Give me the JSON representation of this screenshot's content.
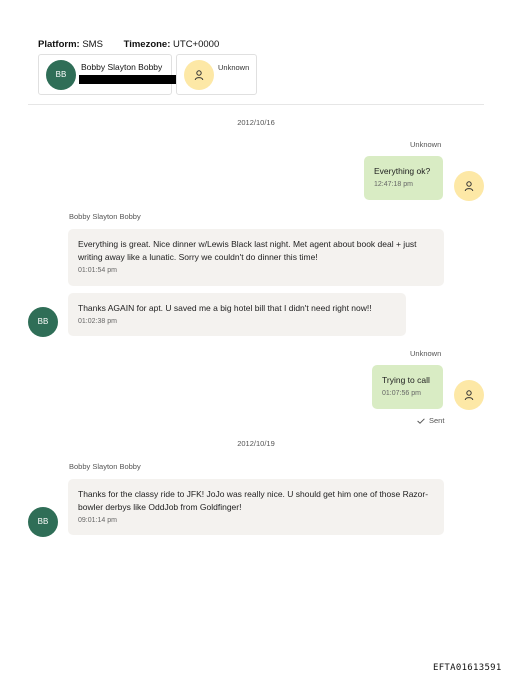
{
  "header": {
    "platform_label": "Platform:",
    "platform_value": "SMS",
    "timezone_label": "Timezone:",
    "timezone_value": "UTC+0000"
  },
  "participants": [
    {
      "initials": "BB",
      "name": "Bobby Slayton Bobby",
      "avatar_color": "#2f6e57"
    },
    {
      "name": "Unknown",
      "avatar_color": "#fde8a6",
      "icon": "person-icon"
    }
  ],
  "conversation": {
    "date1": "2012/10/16",
    "msg1": {
      "sender": "Unknown",
      "text": "Everything ok?",
      "time": "12:47:18 pm"
    },
    "msg2": {
      "sender": "Bobby Slayton Bobby",
      "text": "Everything is great. Nice dinner w/Lewis Black last night. Met agent about book deal + just writing away like a lunatic. Sorry we couldn't do dinner this time!",
      "time": "01:01:54 pm"
    },
    "msg3": {
      "text": "Thanks AGAIN for apt. U saved me a big hotel bill that I didn't need right now!!",
      "time": "01:02:38 pm",
      "initials": "BB"
    },
    "msg4": {
      "sender": "Unknown",
      "text": "Trying to call",
      "time": "01:07:56 pm",
      "status": "Sent"
    },
    "date2": "2012/10/19",
    "msg5": {
      "sender": "Bobby Slayton Bobby",
      "text": "Thanks for the classy ride to JFK! JoJo was really nice. U should get him one of those Razor-bowler derbys like OddJob from Goldfinger!",
      "time": "09:01:14 pm",
      "initials": "BB"
    }
  },
  "colors": {
    "outgoing_bubble": "#d9ecc4",
    "incoming_bubble": "#f4f2ef",
    "bb_avatar": "#2f6e57",
    "unknown_avatar": "#fde8a6"
  },
  "footer": {
    "doc_id": "EFTA01613591"
  }
}
